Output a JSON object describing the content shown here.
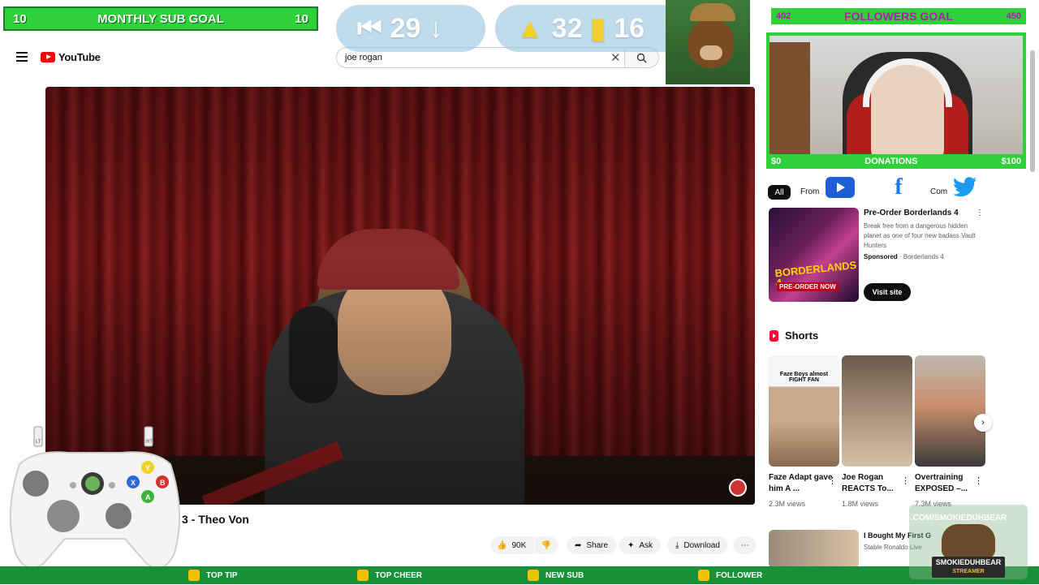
{
  "youtube": {
    "logo_text": "YouTube",
    "search_value": "joe rogan",
    "video_title_partial": "3 - Theo Von",
    "actions": {
      "like_count": "90K",
      "share_label": "Share",
      "ask_label": "Ask",
      "download_label": "Download"
    },
    "chips": {
      "all": "All",
      "from": "From",
      "com": "Com"
    },
    "ad": {
      "title": "Pre-Order Borderlands 4",
      "description": "Break free from a dangerous hidden planet as one of four new badass Vault Hunters",
      "sponsored_label": "Sponsored",
      "advertiser": "Borderlands 4",
      "thumb_logo": "BORDERLANDS 4",
      "thumb_sub": "PRE-ORDER NOW",
      "visit_label": "Visit site"
    },
    "shorts": {
      "header": "Shorts",
      "items": [
        {
          "title": "Faze Adapt gave him A ...",
          "views": "2.3M views",
          "caption": "Faze Boys almost FIGHT FAN"
        },
        {
          "title": "Joe Rogan REACTS To...",
          "views": "1.8M views"
        },
        {
          "title": "Overtraining EXPOSED –...",
          "views": "7.3M views"
        }
      ]
    },
    "recommended": {
      "title": "I Bought My First G",
      "channel": "Stable Ronaldo Live"
    }
  },
  "overlay": {
    "sub_goal": {
      "left": "10",
      "label": "MONTHLY SUB GOAL",
      "right": "10"
    },
    "stats": {
      "stat1": "29",
      "stat2a": "32",
      "stat2b": "16"
    },
    "followers_goal": {
      "current": "402",
      "label": "FOLLOWERS GOAL",
      "target": "450"
    },
    "donations": {
      "min": "$0",
      "label": "DONATIONS",
      "max": "$100"
    },
    "alerts": {
      "tip": "TOP TIP",
      "cheer": "TOP CHEER",
      "sub": "NEW SUB",
      "follower": "FOLLOWER"
    },
    "controller": {
      "lt": "LT",
      "rt": "RT",
      "y": "Y",
      "x": "X",
      "b": "B",
      "a": "A"
    },
    "brand": {
      "url": ".COM/SMOKIEDUHBEAR",
      "name": "SMOKIEDUHBEAR",
      "tag": "STREAMER"
    }
  },
  "colors": {
    "overlay_green": "#2fd13a",
    "yt_red": "#ff0000",
    "followers_text": "#b01bb0"
  }
}
